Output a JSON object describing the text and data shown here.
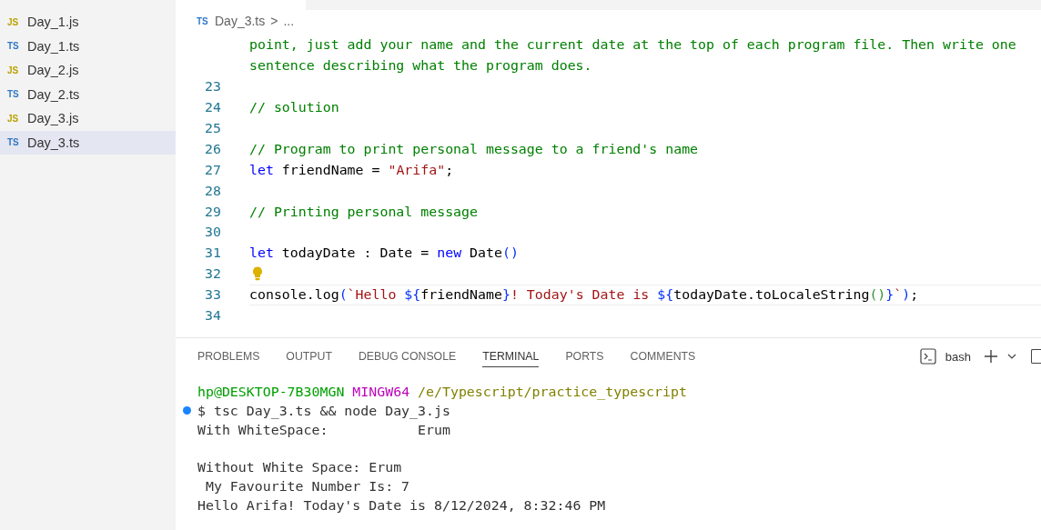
{
  "explorer": {
    "files": [
      {
        "badge": "JS",
        "kind": "js",
        "name": "Day_1.js",
        "selected": false
      },
      {
        "badge": "TS",
        "kind": "ts",
        "name": "Day_1.ts",
        "selected": false
      },
      {
        "badge": "JS",
        "kind": "js",
        "name": "Day_2.js",
        "selected": false
      },
      {
        "badge": "TS",
        "kind": "ts",
        "name": "Day_2.ts",
        "selected": false
      },
      {
        "badge": "JS",
        "kind": "js",
        "name": "Day_3.js",
        "selected": false
      },
      {
        "badge": "TS",
        "kind": "ts",
        "name": "Day_3.ts",
        "selected": true
      }
    ]
  },
  "breadcrumb": {
    "badge": "TS",
    "file": "Day_3.ts",
    "separator": ">",
    "rest": "..."
  },
  "editor": {
    "lines": [
      {
        "current": false,
        "lightbulb": false,
        "tokens": [
          {
            "text": "point, just add your name and the current date at the top of each program file. Then write one",
            "kind": "comment"
          }
        ]
      },
      {
        "current": false,
        "lightbulb": false,
        "tokens": [
          {
            "text": "sentence describing what the program does.",
            "kind": "comment"
          }
        ]
      },
      {
        "number": "23",
        "current": false,
        "lightbulb": false
      },
      {
        "number": "24",
        "current": false,
        "lightbulb": false,
        "tokens": [
          {
            "text": "// solution",
            "kind": "comment"
          }
        ]
      },
      {
        "number": "25",
        "current": false,
        "lightbulb": false
      },
      {
        "number": "26",
        "current": false,
        "lightbulb": false,
        "tokens": [
          {
            "text": "// Program to print personal message to a friend's name",
            "kind": "comment"
          }
        ]
      },
      {
        "number": "27",
        "current": false,
        "lightbulb": false,
        "tokens": [
          {
            "text": "let",
            "kind": "keyword"
          },
          {
            "text": " friendName = ",
            "kind": "plain"
          },
          {
            "text": "\"Arifa\"",
            "kind": "string"
          },
          {
            "text": ";",
            "kind": "plain"
          }
        ]
      },
      {
        "number": "28",
        "current": false,
        "lightbulb": false
      },
      {
        "number": "29",
        "current": false,
        "lightbulb": false,
        "tokens": [
          {
            "text": "// Printing personal message",
            "kind": "comment"
          }
        ]
      },
      {
        "number": "30",
        "current": false,
        "lightbulb": false
      },
      {
        "number": "31",
        "current": false,
        "lightbulb": false,
        "tokens": [
          {
            "text": "let",
            "kind": "keyword"
          },
          {
            "text": " todayDate : Date = ",
            "kind": "plain"
          },
          {
            "text": "new",
            "kind": "keyword"
          },
          {
            "text": " Date",
            "kind": "plain"
          },
          {
            "text": "()",
            "kind": "bracket"
          }
        ]
      },
      {
        "number": "32",
        "current": false,
        "lightbulb": true
      },
      {
        "number": "33",
        "current": true,
        "lightbulb": false,
        "tokens": [
          {
            "text": "console.log",
            "kind": "plain"
          },
          {
            "text": "(",
            "kind": "bracket"
          },
          {
            "text": "`Hello ",
            "kind": "string"
          },
          {
            "text": "${",
            "kind": "bracket"
          },
          {
            "text": "friendName",
            "kind": "plain"
          },
          {
            "text": "}",
            "kind": "bracket"
          },
          {
            "text": "! Today's Date is ",
            "kind": "string"
          },
          {
            "text": "${",
            "kind": "bracket"
          },
          {
            "text": "todayDate.toLocaleString",
            "kind": "plain"
          },
          {
            "text": "()",
            "kind": "bracket2"
          },
          {
            "text": "}",
            "kind": "bracket"
          },
          {
            "text": "`",
            "kind": "string"
          },
          {
            "text": ")",
            "kind": "bracket"
          },
          {
            "text": ";",
            "kind": "plain"
          }
        ]
      },
      {
        "number": "34",
        "current": false,
        "lightbulb": false
      }
    ]
  },
  "panel": {
    "tabs": [
      {
        "label": "PROBLEMS",
        "selected": false
      },
      {
        "label": "OUTPUT",
        "selected": false
      },
      {
        "label": "DEBUG CONSOLE",
        "selected": false
      },
      {
        "label": "TERMINAL",
        "selected": true
      },
      {
        "label": "PORTS",
        "selected": false
      },
      {
        "label": "COMMENTS",
        "selected": false
      }
    ],
    "shell": "bash",
    "terminal": [
      {
        "marker": false,
        "segments": [
          {
            "text": "hp@DESKTOP-7B30MGN",
            "kind": "user"
          },
          {
            "text": " MINGW64",
            "kind": "host"
          },
          {
            "text": " /e/Typescript/practice_typescript",
            "kind": "path"
          }
        ]
      },
      {
        "marker": true,
        "segments": [
          {
            "text": "$ tsc Day_3.ts && node Day_3.js",
            "kind": "plain"
          }
        ]
      },
      {
        "marker": false,
        "segments": [
          {
            "text": "With WhiteSpace:           Erum",
            "kind": "plain"
          }
        ]
      },
      {
        "marker": false
      },
      {
        "marker": false,
        "segments": [
          {
            "text": "Without White Space: Erum",
            "kind": "plain"
          }
        ]
      },
      {
        "marker": false,
        "segments": [
          {
            "text": " My Favourite Number Is: 7",
            "kind": "plain"
          }
        ]
      },
      {
        "marker": false,
        "segments": [
          {
            "text": "Hello Arifa! Today's Date is 8/12/2024, 8:32:46 PM",
            "kind": "plain"
          }
        ]
      }
    ]
  }
}
